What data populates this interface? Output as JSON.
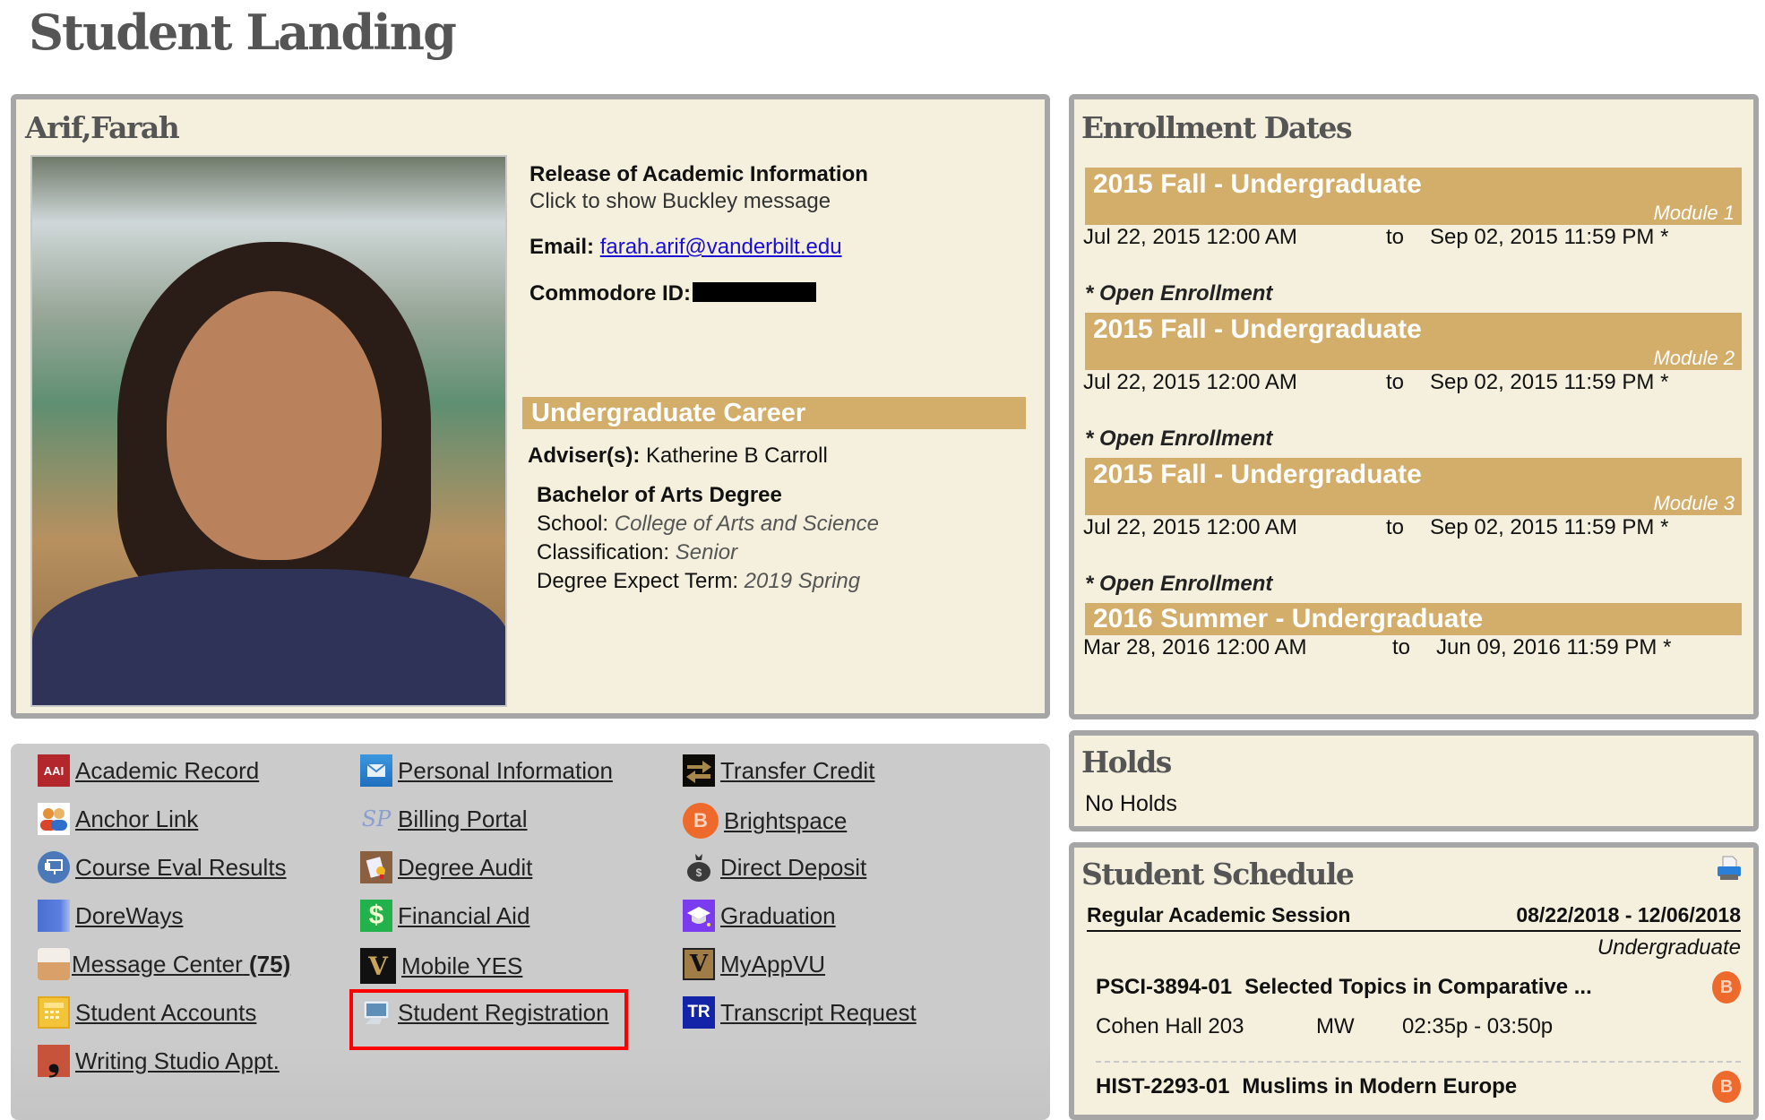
{
  "page": {
    "title": "Student Landing"
  },
  "profile": {
    "name": "Arif,Farah",
    "release_heading": "Release of Academic Information",
    "release_link": "Click to show Buckley message",
    "email_label": "Email:",
    "email": "farah.arif@vanderbilt.edu",
    "commodore_id_label": "Commodore ID:",
    "commodore_id_redacted": true,
    "career_banner": "Undergraduate Career",
    "adviser_label": "Adviser(s):",
    "adviser": "Katherine B Carroll",
    "degree": "Bachelor of Arts Degree",
    "school_label": "School:",
    "school": "College of Arts and Science",
    "classification_label": "Classification:",
    "classification": "Senior",
    "expect_term_label": "Degree Expect Term:",
    "expect_term": "2019 Spring"
  },
  "enrollment": {
    "title": "Enrollment Dates",
    "to_label": "to",
    "open_note": "* Open Enrollment",
    "terms": [
      {
        "term": "2015 Fall - Undergraduate",
        "module": "Module 1",
        "start": "Jul 22, 2015 12:00 AM",
        "end": "Sep 02, 2015 11:59 PM *"
      },
      {
        "term": "2015 Fall - Undergraduate",
        "module": "Module 2",
        "start": "Jul 22, 2015 12:00 AM",
        "end": "Sep 02, 2015 11:59 PM *"
      },
      {
        "term": "2015 Fall - Undergraduate",
        "module": "Module 3",
        "start": "Jul 22, 2015 12:00 AM",
        "end": "Sep 02, 2015 11:59 PM *"
      },
      {
        "term": "2016 Summer - Undergraduate",
        "module": "",
        "start": "Mar 28, 2016 12:00 AM",
        "end": "Jun 09, 2016 11:59 PM *"
      }
    ]
  },
  "links": {
    "columns": [
      [
        {
          "label": "Academic Record",
          "icon": "academic-record-icon"
        },
        {
          "label": "Anchor Link",
          "icon": "people-icon"
        },
        {
          "label": "Course Eval Results",
          "icon": "presentation-icon"
        },
        {
          "label": "DoreWays",
          "icon": "doreways-icon"
        },
        {
          "label": "Message Center",
          "count": "(75)",
          "icon": "inbox-icon"
        },
        {
          "label": "Student Accounts",
          "icon": "calculator-icon"
        },
        {
          "label": "Writing Studio Appt.",
          "icon": "comma-icon"
        }
      ],
      [
        {
          "label": "Personal Information",
          "icon": "envelope-icon"
        },
        {
          "label": "Billing Portal",
          "icon": "sp-logo-icon"
        },
        {
          "label": "Degree Audit",
          "icon": "certificate-icon"
        },
        {
          "label": "Financial Aid",
          "icon": "dollar-icon"
        },
        {
          "label": "Mobile YES",
          "icon": "vanderbilt-v-icon"
        },
        {
          "label": "Student Registration",
          "icon": "monitor-icon",
          "highlighted": true
        }
      ],
      [
        {
          "label": "Transfer Credit",
          "icon": "transfer-arrows-icon"
        },
        {
          "label": "Brightspace",
          "icon": "brightspace-icon"
        },
        {
          "label": "Direct Deposit",
          "icon": "money-bag-icon"
        },
        {
          "label": "Graduation",
          "icon": "graduation-cap-icon"
        },
        {
          "label": "MyAppVU",
          "icon": "vanderbilt-v-icon"
        },
        {
          "label": "Transcript Request",
          "icon": "tr-icon"
        }
      ]
    ]
  },
  "holds": {
    "title": "Holds",
    "status": "No Holds"
  },
  "schedule": {
    "title": "Student Schedule",
    "print_icon": "printer-icon",
    "session": "Regular Academic Session",
    "session_dates": "08/22/2018 - 12/06/2018",
    "career": "Undergraduate",
    "courses": [
      {
        "code": "PSCI-3894-01",
        "title": "Selected Topics in Comparative ...",
        "location": "Cohen Hall 203",
        "days": "MW",
        "time": "02:35p - 03:50p"
      },
      {
        "code": "HIST-2293-01",
        "title": "Muslims in Modern Europe"
      }
    ]
  },
  "colors": {
    "panel_bg": "#F4F0DD",
    "panel_border": "#A6A6A6",
    "banner_gold": "#D3AE6B",
    "links_bg": "#CBCBCB",
    "link_blue": "#1A0DD8",
    "highlight_red": "#FF0000"
  }
}
